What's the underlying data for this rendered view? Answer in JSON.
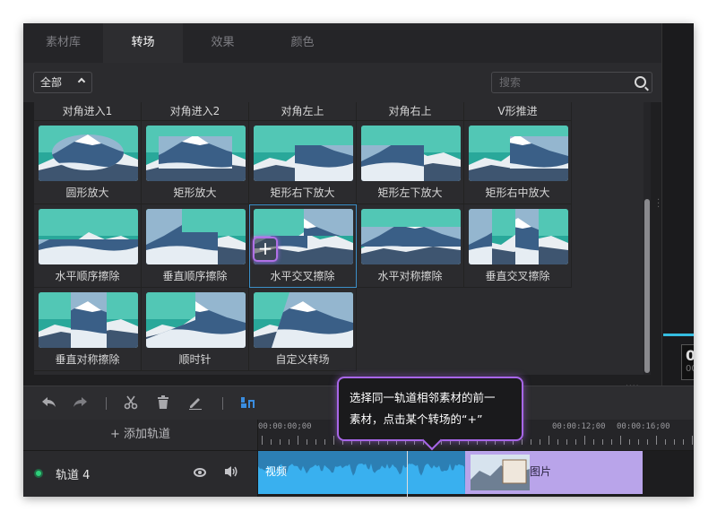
{
  "tabs": [
    {
      "label": "素材库",
      "active": false
    },
    {
      "label": "转场",
      "active": true
    },
    {
      "label": "效果",
      "active": false
    },
    {
      "label": "颜色",
      "active": false
    }
  ],
  "filter": {
    "dropdown_value": "全部",
    "search_placeholder": "搜索"
  },
  "transitions": {
    "header_row": [
      "对角进入1",
      "对角进入2",
      "对角左上",
      "对角右上",
      "V形推进"
    ],
    "items": [
      {
        "label": "圆形放大",
        "icon": "circle-zoom"
      },
      {
        "label": "矩形放大",
        "icon": "rect-zoom"
      },
      {
        "label": "矩形右下放大",
        "icon": "rect-br-zoom"
      },
      {
        "label": "矩形左下放大",
        "icon": "rect-bl-zoom"
      },
      {
        "label": "矩形右中放大",
        "icon": "rect-rm-zoom"
      },
      {
        "label": "水平顺序擦除",
        "icon": "h-seq-wipe"
      },
      {
        "label": "垂直顺序擦除",
        "icon": "v-seq-wipe"
      },
      {
        "label": "水平交叉擦除",
        "icon": "h-cross-wipe",
        "selected": true
      },
      {
        "label": "水平对称擦除",
        "icon": "h-sym-wipe"
      },
      {
        "label": "垂直交叉擦除",
        "icon": "v-cross-wipe"
      },
      {
        "label": "垂直对称擦除",
        "icon": "v-sym-wipe"
      },
      {
        "label": "顺时针",
        "icon": "clockwise"
      },
      {
        "label": "自定义转场",
        "icon": "custom"
      }
    ],
    "add_symbol": "+"
  },
  "toolbar": {
    "icons": [
      "undo-icon",
      "redo-icon",
      "scissors-icon",
      "trash-icon",
      "edit-icon",
      "split-icon"
    ]
  },
  "timeline": {
    "add_track_label": "+ 添加轨道",
    "ruler_marks": [
      "00:00:00;00",
      "00:00:12;00",
      "00:00:16;00"
    ],
    "track": {
      "name": "轨道 4",
      "clips": [
        {
          "label": "视频",
          "kind": "video"
        },
        {
          "label": "图片",
          "kind": "image"
        }
      ]
    }
  },
  "preview": {
    "timecode_main": "0",
    "timecode_sub": "00"
  },
  "tooltip": {
    "line1": "选择同一轨道相邻素材的前一",
    "line2": "素材，点击某个转场的“+”"
  }
}
